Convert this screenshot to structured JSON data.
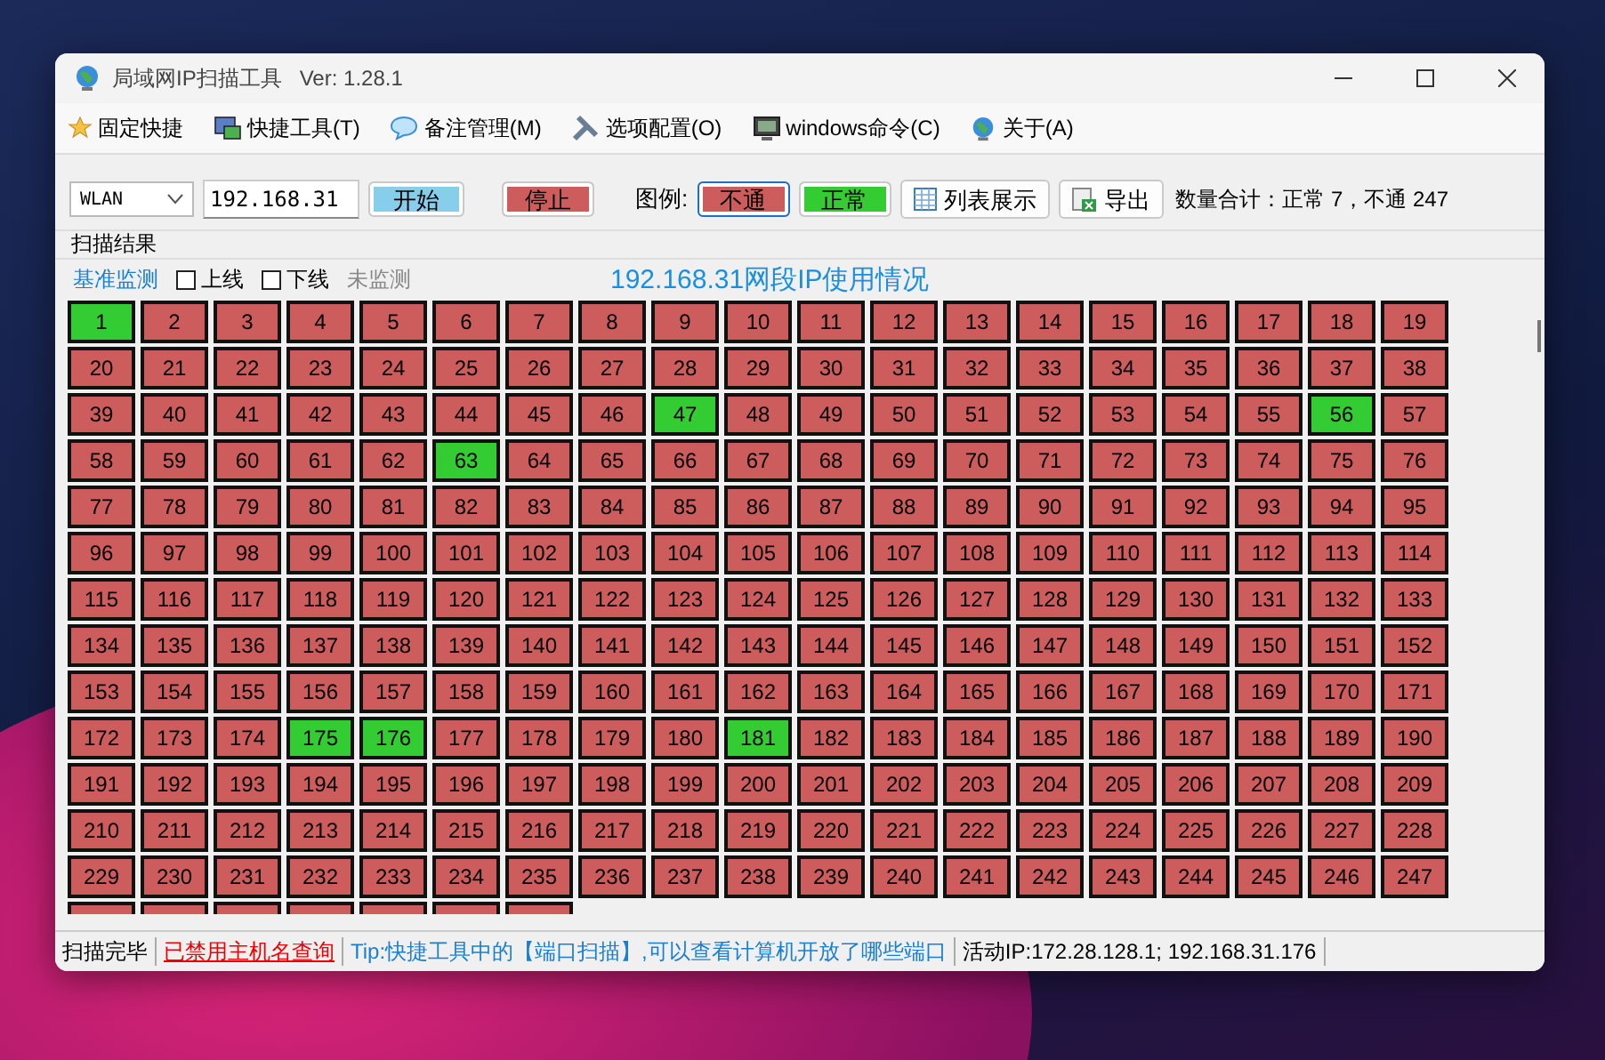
{
  "window": {
    "title": "局域网IP扫描工具",
    "version": "Ver: 1.28.1"
  },
  "menu": [
    {
      "label": "固定快捷"
    },
    {
      "label": "快捷工具(T)"
    },
    {
      "label": "备注管理(M)"
    },
    {
      "label": "选项配置(O)"
    },
    {
      "label": "windows命令(C)"
    },
    {
      "label": "关于(A)"
    }
  ],
  "toolbar": {
    "adapter": "WLAN",
    "ip_prefix": "192.168.31",
    "start": "开始",
    "stop": "停止",
    "legend_label": "图例:",
    "legend": [
      {
        "label": "不通",
        "online": false,
        "focused": true
      },
      {
        "label": "正常",
        "online": true,
        "focused": false
      }
    ],
    "list_view": "列表展示",
    "export": "导出",
    "summary": "数量合计：正常 7，不通 247"
  },
  "group_title": "扫描结果",
  "filters": {
    "baseline": "基准监测",
    "online": {
      "label": "上线",
      "checked": false
    },
    "offline": {
      "label": "下线",
      "checked": false
    },
    "unmonitored": "未监测"
  },
  "grid_title": "192.168.31网段IP使用情况",
  "rows": [
    [
      {
        "label": "1",
        "online": true
      },
      {
        "label": "2",
        "online": false
      },
      {
        "label": "3",
        "online": false
      },
      {
        "label": "4",
        "online": false
      },
      {
        "label": "5",
        "online": false
      },
      {
        "label": "6",
        "online": false
      },
      {
        "label": "7",
        "online": false
      },
      {
        "label": "8",
        "online": false
      },
      {
        "label": "9",
        "online": false
      },
      {
        "label": "10",
        "online": false
      },
      {
        "label": "11",
        "online": false
      },
      {
        "label": "12",
        "online": false
      },
      {
        "label": "13",
        "online": false
      },
      {
        "label": "14",
        "online": false
      },
      {
        "label": "15",
        "online": false
      },
      {
        "label": "16",
        "online": false
      },
      {
        "label": "17",
        "online": false
      },
      {
        "label": "18",
        "online": false
      },
      {
        "label": "19",
        "online": false
      }
    ],
    [
      {
        "label": "20",
        "online": false
      },
      {
        "label": "21",
        "online": false
      },
      {
        "label": "22",
        "online": false
      },
      {
        "label": "23",
        "online": false
      },
      {
        "label": "24",
        "online": false
      },
      {
        "label": "25",
        "online": false
      },
      {
        "label": "26",
        "online": false
      },
      {
        "label": "27",
        "online": false
      },
      {
        "label": "28",
        "online": false
      },
      {
        "label": "29",
        "online": false
      },
      {
        "label": "30",
        "online": false
      },
      {
        "label": "31",
        "online": false
      },
      {
        "label": "32",
        "online": false
      },
      {
        "label": "33",
        "online": false
      },
      {
        "label": "34",
        "online": false
      },
      {
        "label": "35",
        "online": false
      },
      {
        "label": "36",
        "online": false
      },
      {
        "label": "37",
        "online": false
      },
      {
        "label": "38",
        "online": false
      }
    ],
    [
      {
        "label": "39",
        "online": false
      },
      {
        "label": "40",
        "online": false
      },
      {
        "label": "41",
        "online": false
      },
      {
        "label": "42",
        "online": false
      },
      {
        "label": "43",
        "online": false
      },
      {
        "label": "44",
        "online": false
      },
      {
        "label": "45",
        "online": false
      },
      {
        "label": "46",
        "online": false
      },
      {
        "label": "47",
        "online": true
      },
      {
        "label": "48",
        "online": false
      },
      {
        "label": "49",
        "online": false
      },
      {
        "label": "50",
        "online": false
      },
      {
        "label": "51",
        "online": false
      },
      {
        "label": "52",
        "online": false
      },
      {
        "label": "53",
        "online": false
      },
      {
        "label": "54",
        "online": false
      },
      {
        "label": "55",
        "online": false
      },
      {
        "label": "56",
        "online": true
      },
      {
        "label": "57",
        "online": false
      }
    ],
    [
      {
        "label": "58",
        "online": false
      },
      {
        "label": "59",
        "online": false
      },
      {
        "label": "60",
        "online": false
      },
      {
        "label": "61",
        "online": false
      },
      {
        "label": "62",
        "online": false
      },
      {
        "label": "63",
        "online": true
      },
      {
        "label": "64",
        "online": false
      },
      {
        "label": "65",
        "online": false
      },
      {
        "label": "66",
        "online": false
      },
      {
        "label": "67",
        "online": false
      },
      {
        "label": "68",
        "online": false
      },
      {
        "label": "69",
        "online": false
      },
      {
        "label": "70",
        "online": false
      },
      {
        "label": "71",
        "online": false
      },
      {
        "label": "72",
        "online": false
      },
      {
        "label": "73",
        "online": false
      },
      {
        "label": "74",
        "online": false
      },
      {
        "label": "75",
        "online": false
      },
      {
        "label": "76",
        "online": false
      }
    ],
    [
      {
        "label": "77",
        "online": false
      },
      {
        "label": "78",
        "online": false
      },
      {
        "label": "79",
        "online": false
      },
      {
        "label": "80",
        "online": false
      },
      {
        "label": "81",
        "online": false
      },
      {
        "label": "82",
        "online": false
      },
      {
        "label": "83",
        "online": false
      },
      {
        "label": "84",
        "online": false
      },
      {
        "label": "85",
        "online": false
      },
      {
        "label": "86",
        "online": false
      },
      {
        "label": "87",
        "online": false
      },
      {
        "label": "88",
        "online": false
      },
      {
        "label": "89",
        "online": false
      },
      {
        "label": "90",
        "online": false
      },
      {
        "label": "91",
        "online": false
      },
      {
        "label": "92",
        "online": false
      },
      {
        "label": "93",
        "online": false
      },
      {
        "label": "94",
        "online": false
      },
      {
        "label": "95",
        "online": false
      }
    ],
    [
      {
        "label": "96",
        "online": false
      },
      {
        "label": "97",
        "online": false
      },
      {
        "label": "98",
        "online": false
      },
      {
        "label": "99",
        "online": false
      },
      {
        "label": "100",
        "online": false
      },
      {
        "label": "101",
        "online": false
      },
      {
        "label": "102",
        "online": false
      },
      {
        "label": "103",
        "online": false
      },
      {
        "label": "104",
        "online": false
      },
      {
        "label": "105",
        "online": false
      },
      {
        "label": "106",
        "online": false
      },
      {
        "label": "107",
        "online": false
      },
      {
        "label": "108",
        "online": false
      },
      {
        "label": "109",
        "online": false
      },
      {
        "label": "110",
        "online": false
      },
      {
        "label": "111",
        "online": false
      },
      {
        "label": "112",
        "online": false
      },
      {
        "label": "113",
        "online": false
      },
      {
        "label": "114",
        "online": false
      }
    ],
    [
      {
        "label": "115",
        "online": false
      },
      {
        "label": "116",
        "online": false
      },
      {
        "label": "117",
        "online": false
      },
      {
        "label": "118",
        "online": false
      },
      {
        "label": "119",
        "online": false
      },
      {
        "label": "120",
        "online": false
      },
      {
        "label": "121",
        "online": false
      },
      {
        "label": "122",
        "online": false
      },
      {
        "label": "123",
        "online": false
      },
      {
        "label": "124",
        "online": false
      },
      {
        "label": "125",
        "online": false
      },
      {
        "label": "126",
        "online": false
      },
      {
        "label": "127",
        "online": false
      },
      {
        "label": "128",
        "online": false
      },
      {
        "label": "129",
        "online": false
      },
      {
        "label": "130",
        "online": false
      },
      {
        "label": "131",
        "online": false
      },
      {
        "label": "132",
        "online": false
      },
      {
        "label": "133",
        "online": false
      }
    ],
    [
      {
        "label": "134",
        "online": false
      },
      {
        "label": "135",
        "online": false
      },
      {
        "label": "136",
        "online": false
      },
      {
        "label": "137",
        "online": false
      },
      {
        "label": "138",
        "online": false
      },
      {
        "label": "139",
        "online": false
      },
      {
        "label": "140",
        "online": false
      },
      {
        "label": "141",
        "online": false
      },
      {
        "label": "142",
        "online": false
      },
      {
        "label": "143",
        "online": false
      },
      {
        "label": "144",
        "online": false
      },
      {
        "label": "145",
        "online": false
      },
      {
        "label": "146",
        "online": false
      },
      {
        "label": "147",
        "online": false
      },
      {
        "label": "148",
        "online": false
      },
      {
        "label": "149",
        "online": false
      },
      {
        "label": "150",
        "online": false
      },
      {
        "label": "151",
        "online": false
      },
      {
        "label": "152",
        "online": false
      }
    ],
    [
      {
        "label": "153",
        "online": false
      },
      {
        "label": "154",
        "online": false
      },
      {
        "label": "155",
        "online": false
      },
      {
        "label": "156",
        "online": false
      },
      {
        "label": "157",
        "online": false
      },
      {
        "label": "158",
        "online": false
      },
      {
        "label": "159",
        "online": false
      },
      {
        "label": "160",
        "online": false
      },
      {
        "label": "161",
        "online": false
      },
      {
        "label": "162",
        "online": false
      },
      {
        "label": "163",
        "online": false
      },
      {
        "label": "164",
        "online": false
      },
      {
        "label": "165",
        "online": false
      },
      {
        "label": "166",
        "online": false
      },
      {
        "label": "167",
        "online": false
      },
      {
        "label": "168",
        "online": false
      },
      {
        "label": "169",
        "online": false
      },
      {
        "label": "170",
        "online": false
      },
      {
        "label": "171",
        "online": false
      }
    ],
    [
      {
        "label": "172",
        "online": false
      },
      {
        "label": "173",
        "online": false
      },
      {
        "label": "174",
        "online": false
      },
      {
        "label": "175",
        "online": true
      },
      {
        "label": "176",
        "online": true
      },
      {
        "label": "177",
        "online": false
      },
      {
        "label": "178",
        "online": false
      },
      {
        "label": "179",
        "online": false
      },
      {
        "label": "180",
        "online": false
      },
      {
        "label": "181",
        "online": true
      },
      {
        "label": "182",
        "online": false
      },
      {
        "label": "183",
        "online": false
      },
      {
        "label": "184",
        "online": false
      },
      {
        "label": "185",
        "online": false
      },
      {
        "label": "186",
        "online": false
      },
      {
        "label": "187",
        "online": false
      },
      {
        "label": "188",
        "online": false
      },
      {
        "label": "189",
        "online": false
      },
      {
        "label": "190",
        "online": false
      }
    ],
    [
      {
        "label": "191",
        "online": false
      },
      {
        "label": "192",
        "online": false
      },
      {
        "label": "193",
        "online": false
      },
      {
        "label": "194",
        "online": false
      },
      {
        "label": "195",
        "online": false
      },
      {
        "label": "196",
        "online": false
      },
      {
        "label": "197",
        "online": false
      },
      {
        "label": "198",
        "online": false
      },
      {
        "label": "199",
        "online": false
      },
      {
        "label": "200",
        "online": false
      },
      {
        "label": "201",
        "online": false
      },
      {
        "label": "202",
        "online": false
      },
      {
        "label": "203",
        "online": false
      },
      {
        "label": "204",
        "online": false
      },
      {
        "label": "205",
        "online": false
      },
      {
        "label": "206",
        "online": false
      },
      {
        "label": "207",
        "online": false
      },
      {
        "label": "208",
        "online": false
      },
      {
        "label": "209",
        "online": false
      }
    ],
    [
      {
        "label": "210",
        "online": false
      },
      {
        "label": "211",
        "online": false
      },
      {
        "label": "212",
        "online": false
      },
      {
        "label": "213",
        "online": false
      },
      {
        "label": "214",
        "online": false
      },
      {
        "label": "215",
        "online": false
      },
      {
        "label": "216",
        "online": false
      },
      {
        "label": "217",
        "online": false
      },
      {
        "label": "218",
        "online": false
      },
      {
        "label": "219",
        "online": false
      },
      {
        "label": "220",
        "online": false
      },
      {
        "label": "221",
        "online": false
      },
      {
        "label": "222",
        "online": false
      },
      {
        "label": "223",
        "online": false
      },
      {
        "label": "224",
        "online": false
      },
      {
        "label": "225",
        "online": false
      },
      {
        "label": "226",
        "online": false
      },
      {
        "label": "227",
        "online": false
      },
      {
        "label": "228",
        "online": false
      }
    ],
    [
      {
        "label": "229",
        "online": false
      },
      {
        "label": "230",
        "online": false
      },
      {
        "label": "231",
        "online": false
      },
      {
        "label": "232",
        "online": false
      },
      {
        "label": "233",
        "online": false
      },
      {
        "label": "234",
        "online": false
      },
      {
        "label": "235",
        "online": false
      },
      {
        "label": "236",
        "online": false
      },
      {
        "label": "237",
        "online": false
      },
      {
        "label": "238",
        "online": false
      },
      {
        "label": "239",
        "online": false
      },
      {
        "label": "240",
        "online": false
      },
      {
        "label": "241",
        "online": false
      },
      {
        "label": "242",
        "online": false
      },
      {
        "label": "243",
        "online": false
      },
      {
        "label": "244",
        "online": false
      },
      {
        "label": "245",
        "online": false
      },
      {
        "label": "246",
        "online": false
      },
      {
        "label": "247",
        "online": false
      }
    ]
  ],
  "cut_row": [
    {
      "online": false
    },
    {
      "online": false
    },
    {
      "online": false
    },
    {
      "online": false
    },
    {
      "online": false
    },
    {
      "online": false
    },
    {
      "online": false
    }
  ],
  "status_bar": [
    {
      "text": "扫描完毕",
      "kind": "plain"
    },
    {
      "text": "已禁用主机名查询",
      "kind": "warning"
    },
    {
      "text": "Tip:快捷工具中的【端口扫描】,可以查看计算机开放了哪些端口",
      "kind": "tip"
    },
    {
      "text": "活动IP:172.28.128.1; 192.168.31.176",
      "kind": "plain"
    }
  ]
}
